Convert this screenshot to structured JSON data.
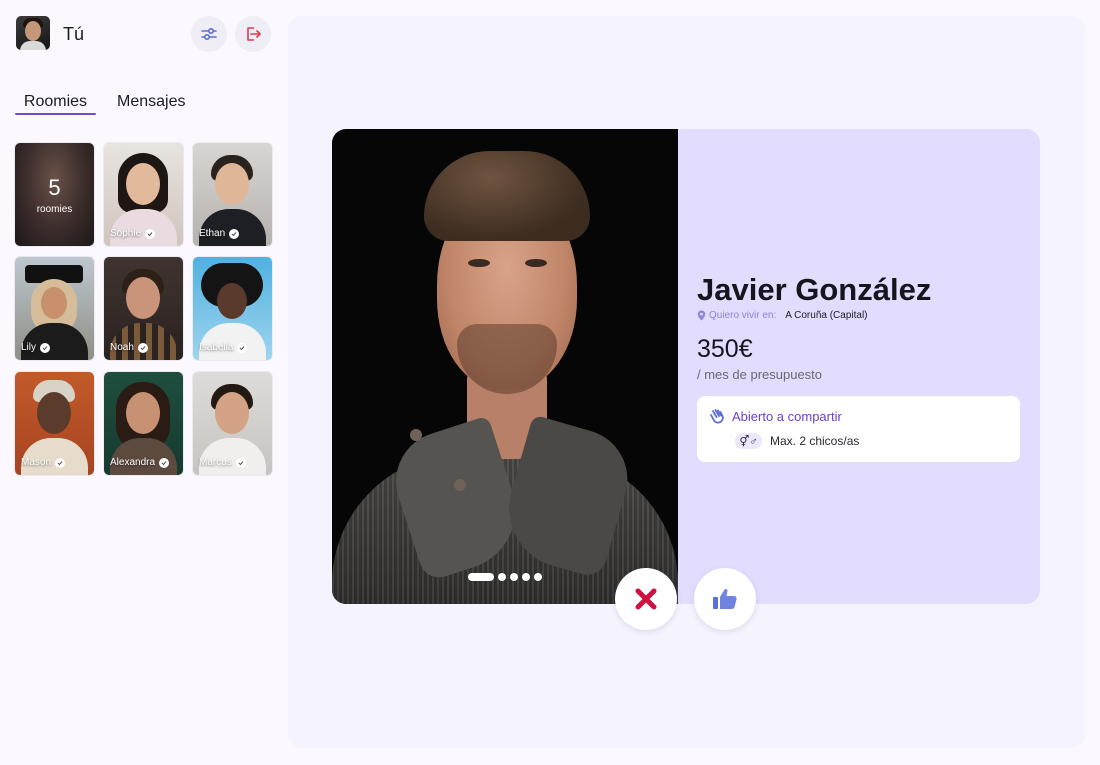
{
  "user": {
    "name": "Tú"
  },
  "tabs": [
    {
      "label": "Roomies"
    },
    {
      "label": "Mensajes"
    }
  ],
  "roomies_counter": {
    "count": "5",
    "label": "roomies"
  },
  "roomies": [
    {
      "name": "Sophie"
    },
    {
      "name": "Ethan"
    },
    {
      "name": "Lily"
    },
    {
      "name": "Noah"
    },
    {
      "name": "Isabella"
    },
    {
      "name": "Mason"
    },
    {
      "name": "Alexandra"
    },
    {
      "name": "Marcus"
    }
  ],
  "profile": {
    "name": "Javier González",
    "location_label": "Quiero vivir en:",
    "location_value": "A Coruña (Capital)",
    "price": "350€",
    "price_sub": "/ mes de presupuesto",
    "sharing_title": "Abierto a compartir",
    "sharing_detail": "Max. 2 chicos/as",
    "photo_count": 5,
    "active_photo": 1
  },
  "colors": {
    "accent": "#6f4bd8",
    "card_bg": "#e2dcff",
    "dislike": "#d0103f",
    "like": "#5c6fd6",
    "logout": "#e53950"
  }
}
